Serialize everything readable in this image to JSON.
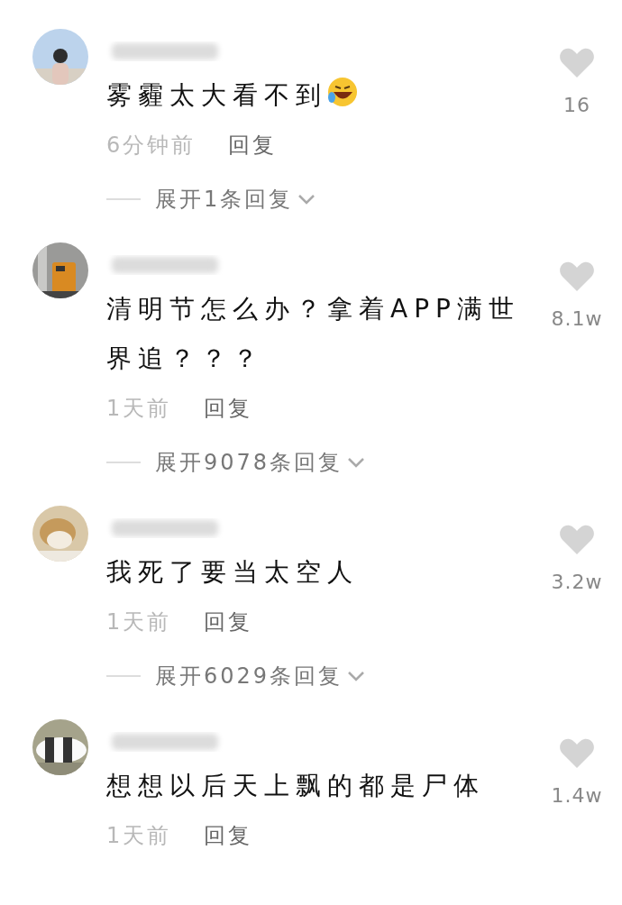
{
  "comments": [
    {
      "avatar": {
        "kind": "picture"
      },
      "content": [
        {
          "kind": "text",
          "text": "雾霾太大看不到"
        },
        {
          "kind": "emoji"
        }
      ],
      "time": "6分钟前",
      "reply": "回复",
      "liked": false,
      "likes": "16",
      "expand": "展开1条回复"
    },
    {
      "avatar": {
        "kind": "picture"
      },
      "content": [
        {
          "kind": "text",
          "text": "清明节怎么办？拿着APP满世界追？？？"
        }
      ],
      "time": "1天前",
      "reply": "回复",
      "liked": false,
      "likes": "8.1w",
      "expand": "展开9078条回复"
    },
    {
      "avatar": {
        "kind": "picture"
      },
      "content": [
        {
          "kind": "text",
          "text": "我死了要当太空人"
        }
      ],
      "time": "1天前",
      "reply": "回复",
      "liked": false,
      "likes": "3.2w",
      "expand": "展开6029条回复"
    },
    {
      "avatar": {
        "kind": "picture"
      },
      "content": [
        {
          "kind": "text",
          "text": "想想以后天上飘的都是尸体"
        }
      ],
      "time": "1天前",
      "reply": "回复",
      "liked": false,
      "likes": "1.4w"
    }
  ]
}
